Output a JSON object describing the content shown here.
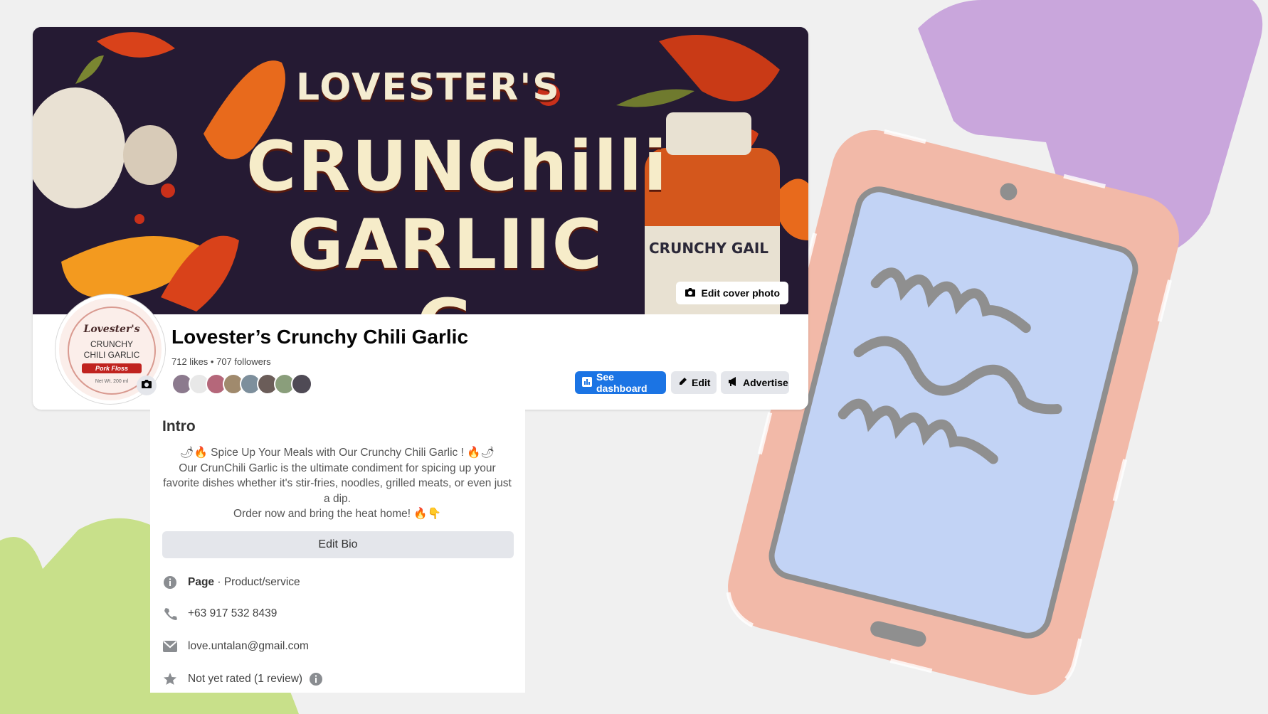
{
  "cover": {
    "brand_line": "LOVESTER'S",
    "title_line1": "CRUNChilli",
    "title_line2": "GARLIIC G",
    "jar_label": "CRUNCHY GAIL",
    "edit_cover_label": "Edit cover photo"
  },
  "avatar": {
    "logo_line1": "Lovester's",
    "logo_line2": "CRUNCHY",
    "logo_line3": "CHILI GARLIC",
    "logo_ribbon": "Pork Floss",
    "logo_net": "Net Wt. 200 ml"
  },
  "page": {
    "name": "Lovester’s Crunchy Chili Garlic",
    "stats": "712 likes • 707 followers"
  },
  "followers": {
    "colors": [
      "#8c7a8e",
      "#e8e8e8",
      "#b5677a",
      "#a08a6d",
      "#7d8f9c",
      "#6b5d59",
      "#8a9e7b",
      "#4f4a55"
    ]
  },
  "actions": {
    "dashboard_label": "See dashboard",
    "edit_label": "Edit",
    "advertise_label": "Advertise"
  },
  "intro": {
    "title": "Intro",
    "bio_line1": "🌶🔥 Spice Up Your Meals with Our Crunchy Chili Garlic ! 🔥🌶",
    "bio_line2": "Our CrunChili Garlic is the ultimate condiment for spicing up your favorite dishes whether it's stir-fries, noodles, grilled meats, or even just a dip.",
    "bio_line3": "Order now and bring the heat home! 🔥👇",
    "edit_bio_label": "Edit Bio",
    "category_bold": "Page",
    "category": " · Product/service",
    "phone": "+63 917 532 8439",
    "email": "love.untalan@gmail.com",
    "rating": "Not yet rated (1 review)"
  },
  "colors": {
    "accent": "#1b74e4",
    "purple_deco": "#c9a6dc",
    "green_deco": "#c8e08a",
    "tablet_body": "#f2b9a8",
    "tablet_screen": "#c2d3f5"
  }
}
